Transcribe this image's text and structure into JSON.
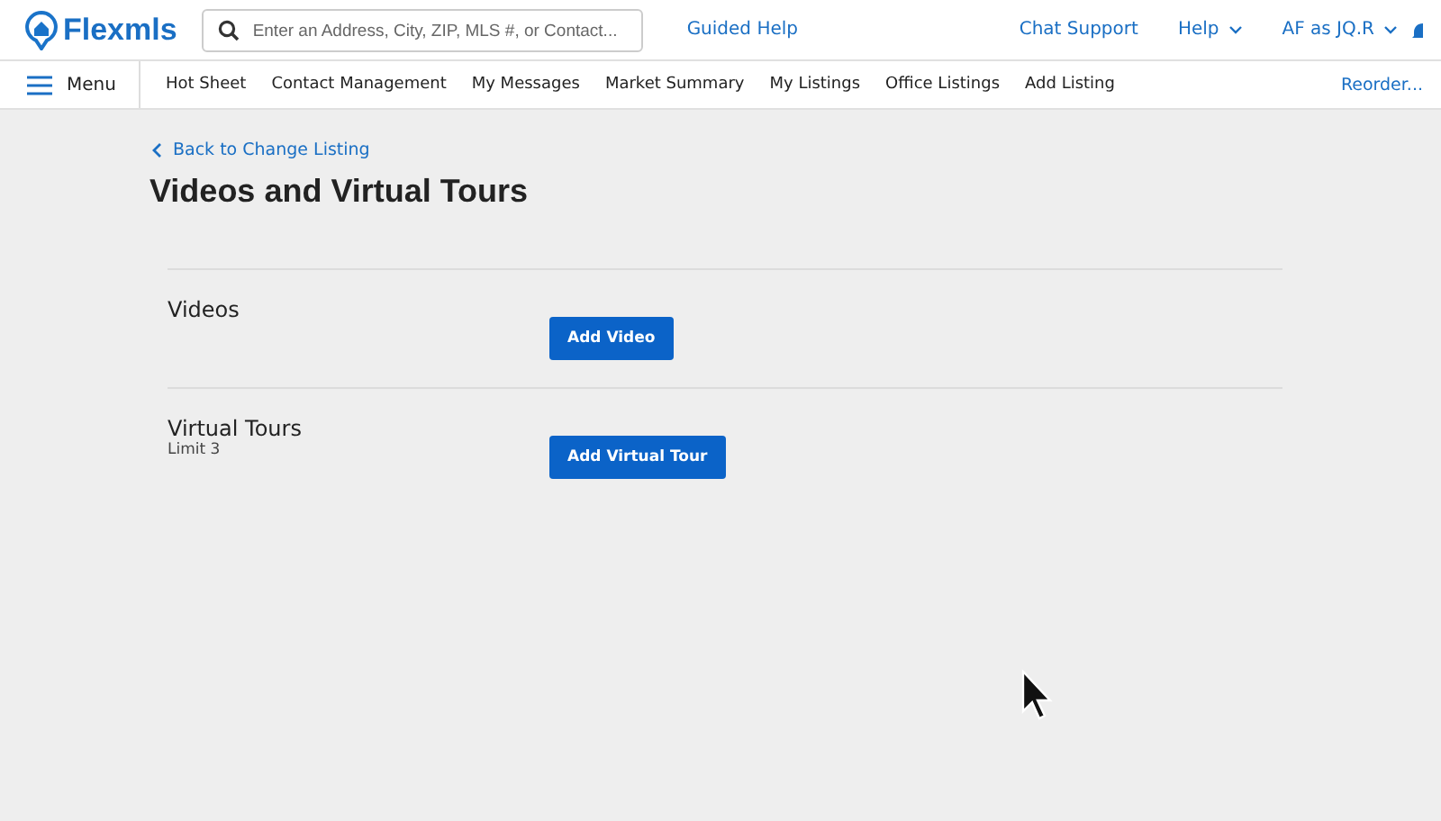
{
  "header": {
    "logo": "Flexmls",
    "search": {
      "placeholder": "Enter an Address, City, ZIP, MLS #, or Contact..."
    },
    "guided_help": "Guided Help",
    "links": [
      {
        "label": "Chat Support",
        "dropdown": false
      },
      {
        "label": "Help",
        "dropdown": true
      },
      {
        "label": "AF as JQ.R",
        "dropdown": true
      }
    ]
  },
  "nav": {
    "menu": "Menu",
    "items": [
      "Hot Sheet",
      "Contact Management",
      "My Messages",
      "Market Summary",
      "My Listings",
      "Office Listings",
      "Add Listing"
    ],
    "reorder": "Reorder..."
  },
  "back_link": "Back to Change Listing",
  "title": "Videos and Virtual Tours",
  "sections": [
    {
      "label": "Videos",
      "button": "Add Video"
    },
    {
      "label": "Virtual Tours",
      "note": "Limit 3",
      "button": "Add Virtual Tour"
    }
  ]
}
